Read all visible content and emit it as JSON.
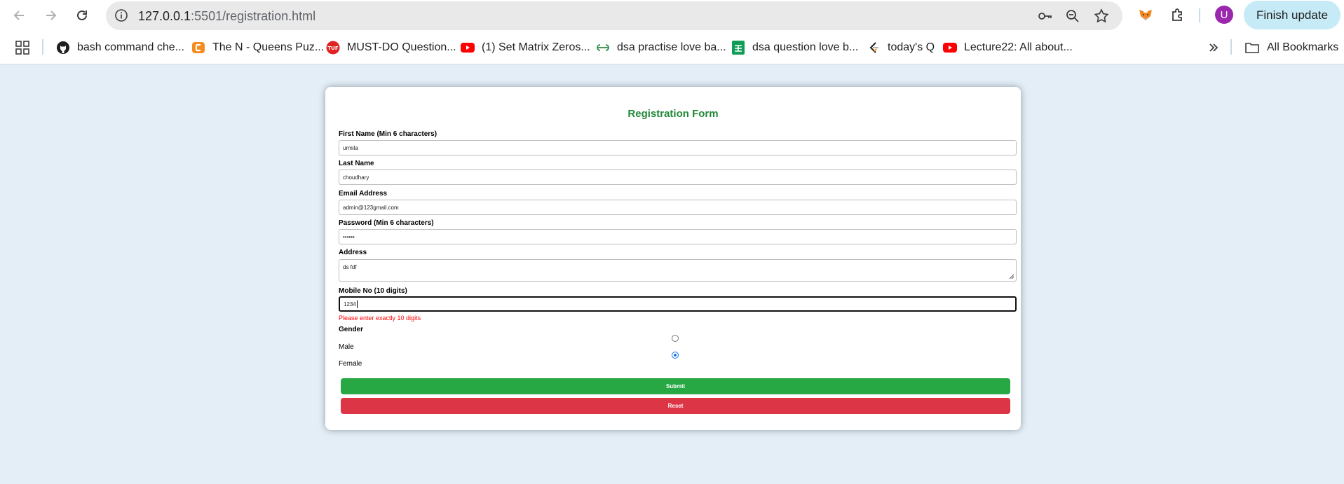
{
  "browser": {
    "url_host": "127.0.0.1",
    "url_path": ":5501/registration.html",
    "avatar_letter": "U",
    "update_label": "Finish update",
    "all_bookmarks_label": "All Bookmarks",
    "bookmarks": [
      {
        "label": "bash command che...",
        "icon": "github-icon"
      },
      {
        "label": "The N - Queens Puz...",
        "icon": "codingninjas-icon"
      },
      {
        "label": "MUST-DO Question...",
        "icon": "tuf-icon"
      },
      {
        "label": "(1) Set Matrix Zeros...",
        "icon": "youtube-icon"
      },
      {
        "label": "dsa practise love ba...",
        "icon": "geeksforgeeks-icon"
      },
      {
        "label": "dsa question love b...",
        "icon": "google-sheets-icon"
      },
      {
        "label": "today's Q",
        "icon": "leetcode-icon"
      },
      {
        "label": "Lecture22: All about...",
        "icon": "youtube-icon"
      }
    ]
  },
  "form": {
    "title": "Registration Form",
    "first_name": {
      "label": "First Name (Min 6 characters)",
      "value": "urmila"
    },
    "last_name": {
      "label": "Last Name",
      "value": "choudhary"
    },
    "email": {
      "label": "Email Address",
      "value": "admin@123gmail.com"
    },
    "password": {
      "label": "Password (Min 6 characters)",
      "value": "••••••"
    },
    "address": {
      "label": "Address",
      "value": "ds fdf"
    },
    "mobile": {
      "label": "Mobile No (10 digits)",
      "value": "1234",
      "error": "Please enter exactly 10 digits"
    },
    "gender": {
      "label": "Gender",
      "options": [
        {
          "label": "Male",
          "checked": false
        },
        {
          "label": "Female",
          "checked": true
        }
      ]
    },
    "submit_label": "Submit",
    "reset_label": "Reset"
  },
  "colors": {
    "title": "#218838",
    "submit": "#28a745",
    "reset": "#dc3545",
    "error": "#ff0000",
    "page_bg": "#e3eef7"
  }
}
